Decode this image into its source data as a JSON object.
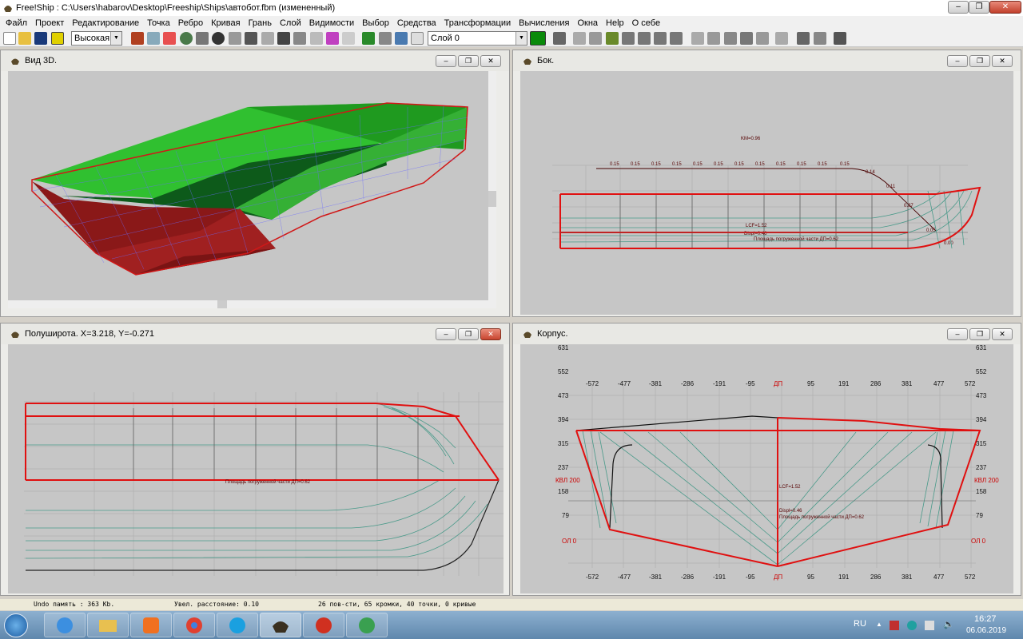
{
  "window": {
    "title": "Free!Ship  : C:\\Users\\habarov\\Desktop\\Freeship\\Ships\\автобот.fbm (измененный)"
  },
  "menu": [
    "Файл",
    "Проект",
    "Редактирование",
    "Точка",
    "Ребро",
    "Кривая",
    "Грань",
    "Слой",
    "Видимости",
    "Выбор",
    "Средства",
    "Трансформации",
    "Вычисления",
    "Окна",
    "Help",
    "О себе"
  ],
  "toolbar": {
    "quality_value": "Высокая",
    "layer_value": "Слой 0",
    "layer_color": "#0a8a0a"
  },
  "panes": {
    "view3d": {
      "title": "Вид 3D."
    },
    "side": {
      "title": "Бок.",
      "km_label": "KM=0.96",
      "curve_values": [
        "0.15",
        "0.15",
        "0.15",
        "0.15",
        "0.15",
        "0.15",
        "0.15",
        "0.15",
        "0.15",
        "0.15",
        "0.15",
        "0.15",
        "0.14",
        "0.11",
        "0.07",
        "0.05",
        "0.00"
      ],
      "lcf_label": "LCF=1.52",
      "displ_label": "Displ=0.46",
      "area_label": "Площадь погруженной части ДП=0.62"
    },
    "plan": {
      "title": "Полуширота.  X=3.218,   Y=-0.271",
      "area_label": "Площадь погруженной части ДП=0.62"
    },
    "body": {
      "title": "Корпус.",
      "x_ticks": [
        "-572",
        "-477",
        "-381",
        "-286",
        "-191",
        "-95",
        "ДП",
        "95",
        "191",
        "286",
        "381",
        "477",
        "572"
      ],
      "y_ticks": [
        "631",
        "552",
        "473",
        "394",
        "315",
        "237",
        "158",
        "79"
      ],
      "kvl_label": "КВЛ 200",
      "ol_label": "ОЛ 0",
      "lcf_label": "LCF=1.52",
      "displ_label": "Displ=0.46",
      "area_label": "Площадь погруженной части ДП=0.62"
    }
  },
  "status": {
    "undo": "Undo память : 363 Kb.",
    "zoom": "Увел. расстояние: 0.10",
    "counts": "26 пов-сти, 65 кромки, 40 точки, 0 кривые"
  },
  "taskbar": {
    "lang": "RU",
    "time": "16:27",
    "date": "06.06.2019"
  },
  "colors": {
    "hull_green": "#2ec02e",
    "hull_red": "#b01e1e",
    "outline_red": "#e01010",
    "section_teal": "#4a9a8a",
    "viewport_bg": "#c6c6c6"
  }
}
